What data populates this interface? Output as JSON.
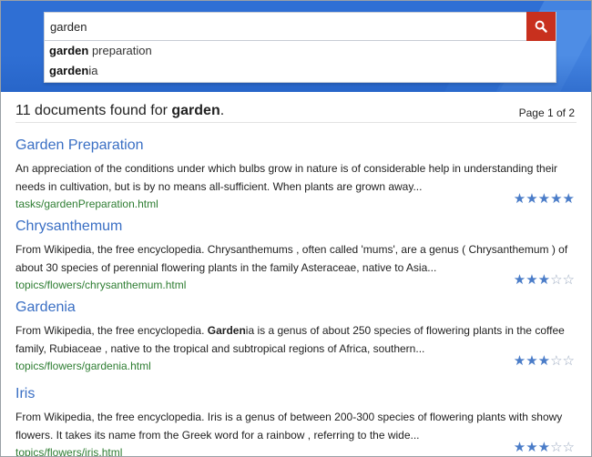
{
  "search": {
    "query": "garden",
    "placeholder": "",
    "button_icon": "search-icon"
  },
  "suggestions": [
    {
      "match": "garden",
      "rest": " preparation"
    },
    {
      "match": "garden",
      "rest": "ia"
    }
  ],
  "results_summary": {
    "prefix": "11 documents found for ",
    "term": "garden",
    "suffix": ".",
    "pager": "Page 1 of 2"
  },
  "results": [
    {
      "title": "Garden Preparation",
      "snippet_pre": "An appreciation of the conditions under which bulbs grow in nature is of considerable help in understanding their needs in cultivation, but is by no means all-sufficient. When plants are grown away...",
      "snippet_bold": "",
      "snippet_post": "",
      "url": "tasks/gardenPreparation.html",
      "rating": 5,
      "rating_max": 5
    },
    {
      "title": "Chrysanthemum",
      "snippet_pre": "From Wikipedia, the free encyclopedia. Chrysanthemums , often called 'mums', are a genus ( Chrysanthemum ) of about 30 species of perennial flowering plants in the family Asteraceae, native to Asia...",
      "snippet_bold": "",
      "snippet_post": "",
      "url": "topics/flowers/chrysanthemum.html",
      "rating": 3,
      "rating_max": 5
    },
    {
      "title": "Gardenia",
      "snippet_pre": "From Wikipedia, the free encyclopedia. ",
      "snippet_bold": "Garden",
      "snippet_post": "ia is a genus of about 250 species of flowering plants in the coffee family, Rubiaceae , native to the tropical and subtropical regions of Africa, southern...",
      "url": "topics/flowers/gardenia.html",
      "rating": 3,
      "rating_max": 5
    },
    {
      "title": "Iris",
      "snippet_pre": "From Wikipedia, the free encyclopedia. Iris is a genus of between 200-300 species of flowering plants with showy flowers. It takes its name from the Greek word for a rainbow , referring to the wide...",
      "snippet_bold": "",
      "snippet_post": "",
      "url": "topics/flowers/iris.html",
      "rating": 3,
      "rating_max": 5
    }
  ],
  "colors": {
    "header": "#2f6fd4",
    "search_button": "#c8301e",
    "link": "#3a6fc4",
    "url": "#2e7d32",
    "star": "#4a7cc8"
  }
}
